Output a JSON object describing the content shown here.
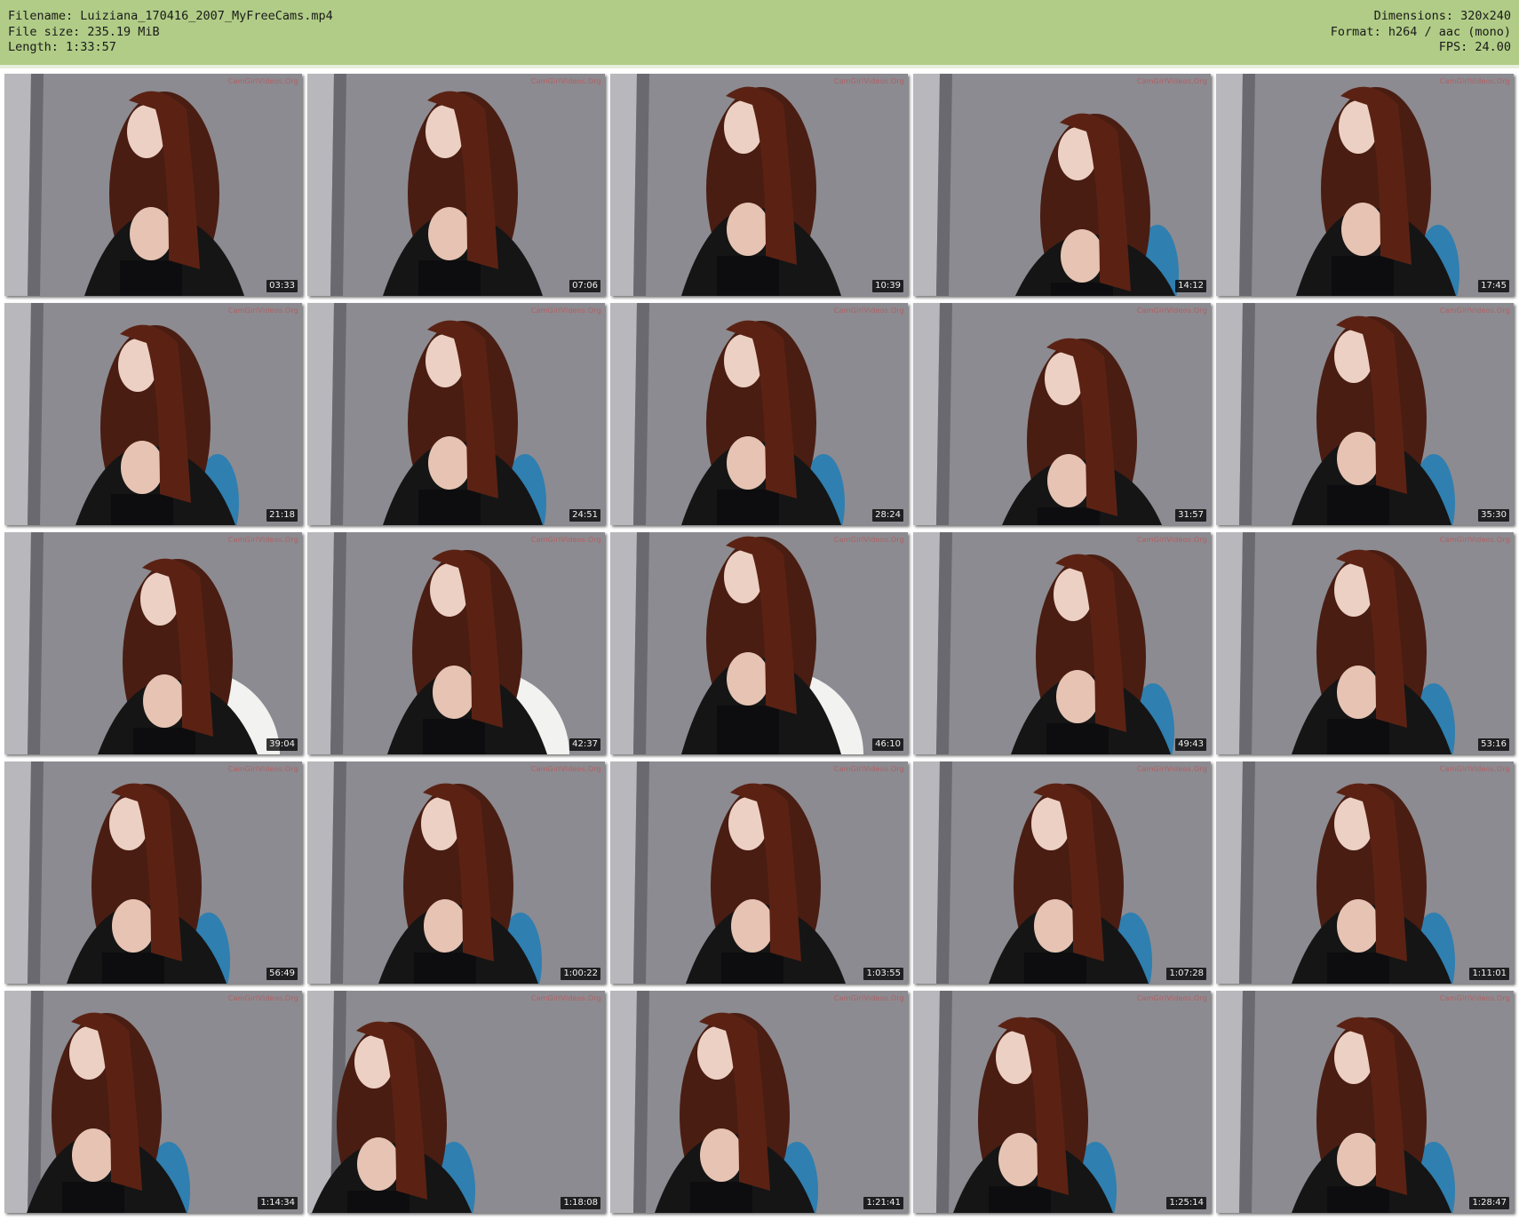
{
  "header": {
    "left_lines": [
      "Filename: Luiziana_170416_2007_MyFreeCams.mp4",
      "File size: 235.19 MiB",
      "Length: 1:33:57"
    ],
    "right_lines": [
      "Dimensions: 320x240",
      "Format: h264 / aac (mono)",
      "FPS: 24.00"
    ],
    "background_color": "#b0cc86"
  },
  "thumbnails": [
    {
      "timestamp": "03:33"
    },
    {
      "timestamp": "07:06"
    },
    {
      "timestamp": "10:39"
    },
    {
      "timestamp": "14:12"
    },
    {
      "timestamp": "17:45"
    },
    {
      "timestamp": "21:18"
    },
    {
      "timestamp": "24:51"
    },
    {
      "timestamp": "28:24"
    },
    {
      "timestamp": "31:57"
    },
    {
      "timestamp": "35:30"
    },
    {
      "timestamp": "39:04"
    },
    {
      "timestamp": "42:37"
    },
    {
      "timestamp": "46:10"
    },
    {
      "timestamp": "49:43"
    },
    {
      "timestamp": "53:16"
    },
    {
      "timestamp": "56:49"
    },
    {
      "timestamp": "1:00:22"
    },
    {
      "timestamp": "1:03:55"
    },
    {
      "timestamp": "1:07:28"
    },
    {
      "timestamp": "1:11:01"
    },
    {
      "timestamp": "1:14:34"
    },
    {
      "timestamp": "1:18:08"
    },
    {
      "timestamp": "1:21:41"
    },
    {
      "timestamp": "1:25:14"
    },
    {
      "timestamp": "1:28:47"
    }
  ],
  "watermark_text": "CamGirlVideos.Org"
}
